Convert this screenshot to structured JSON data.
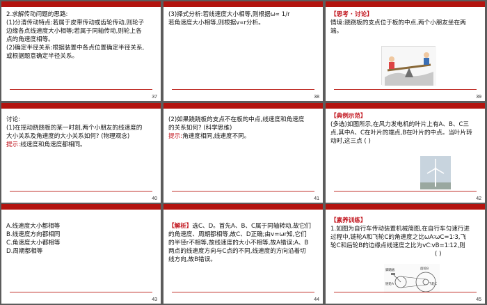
{
  "slides": [
    {
      "number": "37",
      "lines": [
        "2.求解传动问题的思路:",
        "(1)分清传动特点:若属于皮带传动或齿轮传动,则轮子",
        "边缘各点线速度大小相等;若属于同轴传动,则轮上各",
        "点的角速度相等。",
        "(2)确定半径关系:根据装置中各点位置确定半径关系,",
        "或根据题意确定半径关系。"
      ]
    },
    {
      "number": "38",
      "lines": [
        "(3)择式分析:若线速度大小相等,则根据ω∝ 1/r",
        "若角速度大小相等,则根据v∝r分析。"
      ]
    },
    {
      "number": "39",
      "heading": "【思考 · 讨论】",
      "lines": [
        "情境:跷跷板的支点位于板的中点,两个小朋友坐在两",
        "端。"
      ]
    },
    {
      "number": "40",
      "lines": [
        "讨论:",
        "(1)在摇动跷跷板的某一时刻,两个小朋友的线速度的",
        "大小关系及角速度的大小关系如何?   (物理观念)"
      ],
      "hint_label": "提示:",
      "hint_text": "线速度和角速度都相同。"
    },
    {
      "number": "41",
      "lines": [
        "(2)如果跷跷板的支点不在板的中点,线速度和角速度",
        "的关系如何?      (科学思维)"
      ],
      "hint_label": "提示:",
      "hint_text": "角速度相同,线速度不同。"
    },
    {
      "number": "42",
      "heading": "【典例示范】",
      "lines": [
        "(多选)如图所示,在风力发电机的叶片上有A、B、C三",
        "点,其中A、C在叶片的端点,B在叶片的中点。当叶片转",
        "动时,这三点   (     )"
      ]
    },
    {
      "number": "43",
      "lines": [
        "A.线速度大小都相等",
        "B.线速度方向都相同",
        "C.角速度大小都相等",
        "D.周期都相等"
      ]
    },
    {
      "number": "44",
      "heading": "【解析】",
      "lines": [
        "选C、D。首先A、B、C属于同轴转动,故它们",
        "的角速度、周期都相等,故C、D正确;由v=ωr知,它们",
        "的半径r不相等,故线速度的大小不相等,故A错误;A、B",
        "两点的线速度方向与C点的不同,线速度的方向沿着切",
        "线方向,故B错误。"
      ]
    },
    {
      "number": "45",
      "heading": "【素养训练】",
      "lines": [
        "1.如图为自行车传动装置机械简图,在自行车匀速行进",
        "过程中,链轮A和飞轮C的角速度之比ωA∶ωC=1∶3,飞",
        "轮C和后轮B的边缘点线速度之比为vC∶vB=1∶12,则",
        "(     )"
      ],
      "diagram_labels": [
        "后轮B",
        "脚踏板",
        "链轮A",
        "飞轮C"
      ]
    }
  ],
  "colors": {
    "accent": "#b3140f",
    "hint": "#c1121b"
  }
}
